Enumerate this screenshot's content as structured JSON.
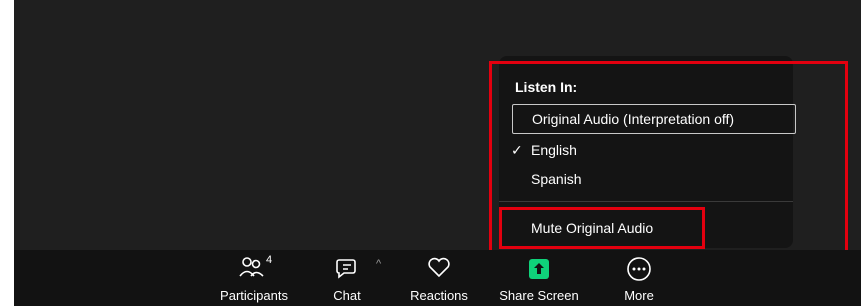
{
  "menu": {
    "header": "Listen In:",
    "items": [
      {
        "label": "Original Audio (Interpretation off)",
        "checked": false,
        "focused": true
      },
      {
        "label": "English",
        "checked": true,
        "focused": false
      },
      {
        "label": "Spanish",
        "checked": false,
        "focused": false
      }
    ],
    "mute_label": "Mute Original Audio",
    "check_glyph": "✓"
  },
  "toolbar": {
    "participants_label": "Participants",
    "participants_count": "4",
    "chat_label": "Chat",
    "reactions_label": "Reactions",
    "share_label": "Share Screen",
    "more_label": "More"
  },
  "colors": {
    "highlight": "#e3000f",
    "share_green": "#0fd27a",
    "background": "#1f1f1f",
    "menu_bg": "#141414"
  }
}
